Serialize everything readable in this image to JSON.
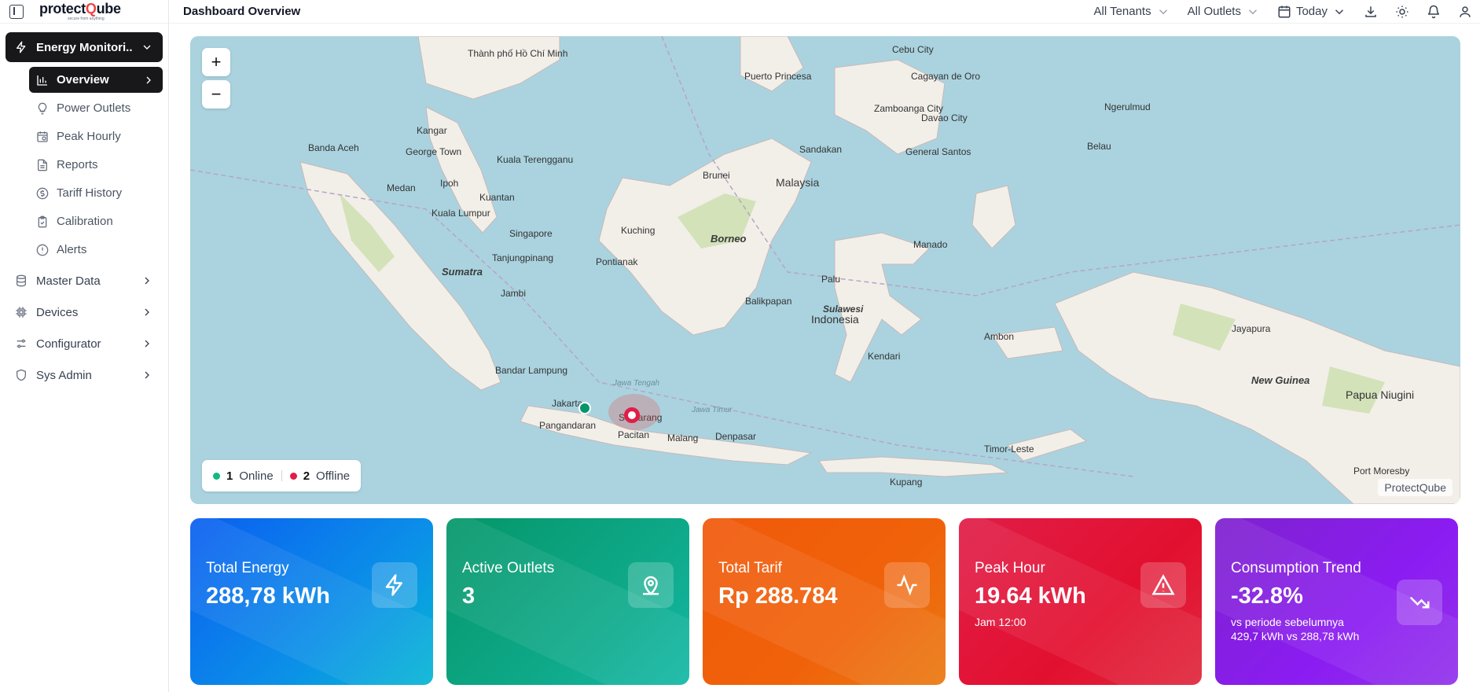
{
  "brand": {
    "name_prefix": "protect",
    "name_highlight": "Q",
    "name_suffix": "ube",
    "tagline": "secure from anything"
  },
  "header": {
    "title": "Dashboard Overview",
    "tenant_filter": "All Tenants",
    "outlet_filter": "All Outlets",
    "date_filter": "Today"
  },
  "sidebar": {
    "active_group": "Energy Monitori...",
    "sub_items": [
      {
        "label": "Overview",
        "icon": "bar-chart-icon"
      },
      {
        "label": "Power Outlets",
        "icon": "lightbulb-icon"
      },
      {
        "label": "Peak Hourly",
        "icon": "calendar-clock-icon"
      },
      {
        "label": "Reports",
        "icon": "file-text-icon"
      },
      {
        "label": "Tariff History",
        "icon": "dollar-circle-icon"
      },
      {
        "label": "Calibration",
        "icon": "clipboard-check-icon"
      },
      {
        "label": "Alerts",
        "icon": "alert-circle-icon"
      }
    ],
    "groups": [
      {
        "label": "Master Data",
        "icon": "database-icon"
      },
      {
        "label": "Devices",
        "icon": "chip-icon"
      },
      {
        "label": "Configurator",
        "icon": "sliders-icon"
      },
      {
        "label": "Sys Admin",
        "icon": "shield-icon"
      }
    ]
  },
  "map": {
    "zoom_in": "+",
    "zoom_out": "−",
    "attribution": "ProtectQube",
    "legend": {
      "online_count": "1",
      "online_label": "Online",
      "offline_count": "2",
      "offline_label": "Offline",
      "online_color": "#10b981",
      "offline_color": "#e11d48"
    },
    "labels": [
      "Thành phố Hồ Chí Minh",
      "Cebu City",
      "Puerto Princesa",
      "Cagayan de Oro",
      "Zamboanga City",
      "Davao City",
      "Ngerulmud",
      "Belau",
      "Banda Aceh",
      "Kangar",
      "George Town",
      "Kuala Terengganu",
      "Sandakan",
      "General Santos",
      "Brunei",
      "Malaysia",
      "Medan",
      "Ipoh",
      "Kuantan",
      "Kuala Lumpur",
      "Singapore",
      "Kuching",
      "Borneo",
      "Tanjungpinang",
      "Pontianak",
      "Sumatra",
      "Manado",
      "Palu",
      "Jambi",
      "Balikpapan",
      "Sulawesi",
      "Indonesia",
      "Jayapura",
      "Ambon",
      "Kendari",
      "Bandar Lampung",
      "New Guinea",
      "Papua Niugini",
      "Jakarta",
      "Pangandaran",
      "Semarang",
      "Pacitan",
      "Malang",
      "Denpasar",
      "Timor-Leste",
      "Kupang",
      "Port Moresby",
      "Jawa Tengah",
      "Jawa Timur"
    ]
  },
  "cards": [
    {
      "title": "Total Energy",
      "value": "288,78 kWh",
      "icon": "zap-icon"
    },
    {
      "title": "Active Outlets",
      "value": "3",
      "icon": "map-pin-icon"
    },
    {
      "title": "Total Tarif",
      "value": "Rp 288.784",
      "icon": "activity-icon"
    },
    {
      "title": "Peak Hour",
      "value": "19.64 kWh",
      "sub1": "Jam 12:00",
      "icon": "alert-triangle-icon"
    },
    {
      "title": "Consumption Trend",
      "value": "-32.8%",
      "sub1": "vs periode sebelumnya",
      "sub2": "429,7 kWh vs 288,78 kWh",
      "icon": "trending-down-icon"
    }
  ]
}
